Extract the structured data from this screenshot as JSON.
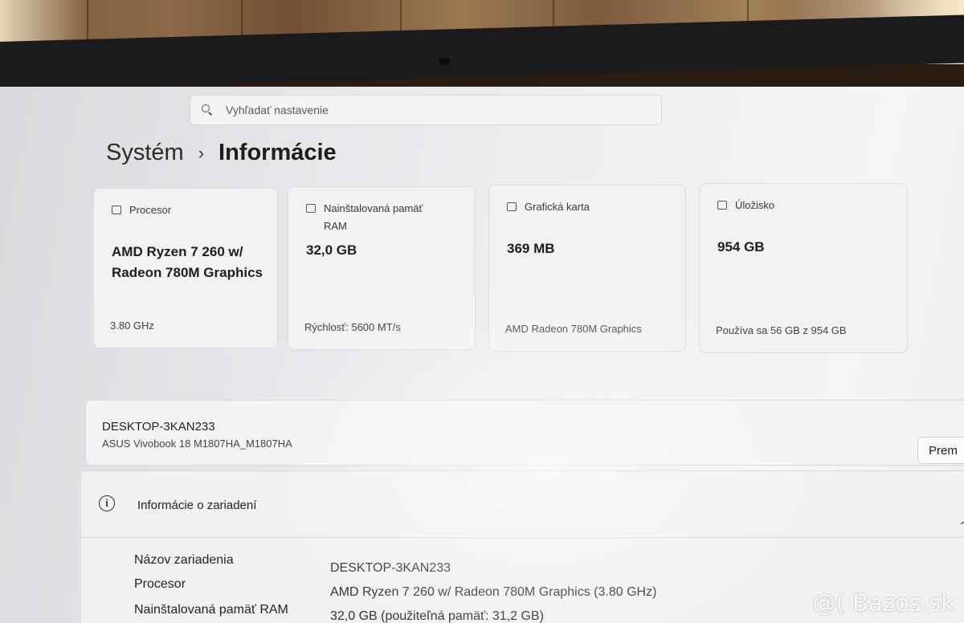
{
  "search": {
    "placeholder": "Vyhľadať nastavenie"
  },
  "breadcrumb": {
    "parent": "Systém",
    "separator": "›",
    "current": "Informácie"
  },
  "cards": [
    {
      "icon": "processor-icon",
      "title": "Procesor",
      "value": "AMD Ryzen 7 260 w/ Radeon 780M Graphics",
      "detail": "3.80 GHz"
    },
    {
      "icon": "memory-icon",
      "title": "Nainštalovaná pamäť RAM",
      "value": "32,0 GB",
      "detail": "Rýchlosť: 5600 MT/s"
    },
    {
      "icon": "graphics-card-icon",
      "title": "Grafická karta",
      "value": "369 MB",
      "detail": "AMD Radeon 780M Graphics"
    },
    {
      "icon": "storage-icon",
      "title": "Úložisko",
      "value": "954 GB",
      "detail": "Používa sa 56 GB z 954 GB"
    }
  ],
  "device": {
    "name": "DESKTOP-3KAN233",
    "model": "ASUS Vivobook 18 M1807HA_M1807HA",
    "rename_label": "Prem"
  },
  "device_info": {
    "icon": "info-icon",
    "title": "Informácie o zariadení",
    "rows": [
      {
        "label": "Názov zariadenia",
        "value": "DESKTOP-3KAN233"
      },
      {
        "label": "Procesor",
        "value": "AMD Ryzen 7 260 w/ Radeon 780M Graphics (3.80 GHz)"
      },
      {
        "label": "Nainštalovaná pamäť RAM",
        "value": "32,0 GB (použiteľná pamäť: 31,2 GB)"
      }
    ]
  },
  "watermark": "@( Bazos.sk"
}
